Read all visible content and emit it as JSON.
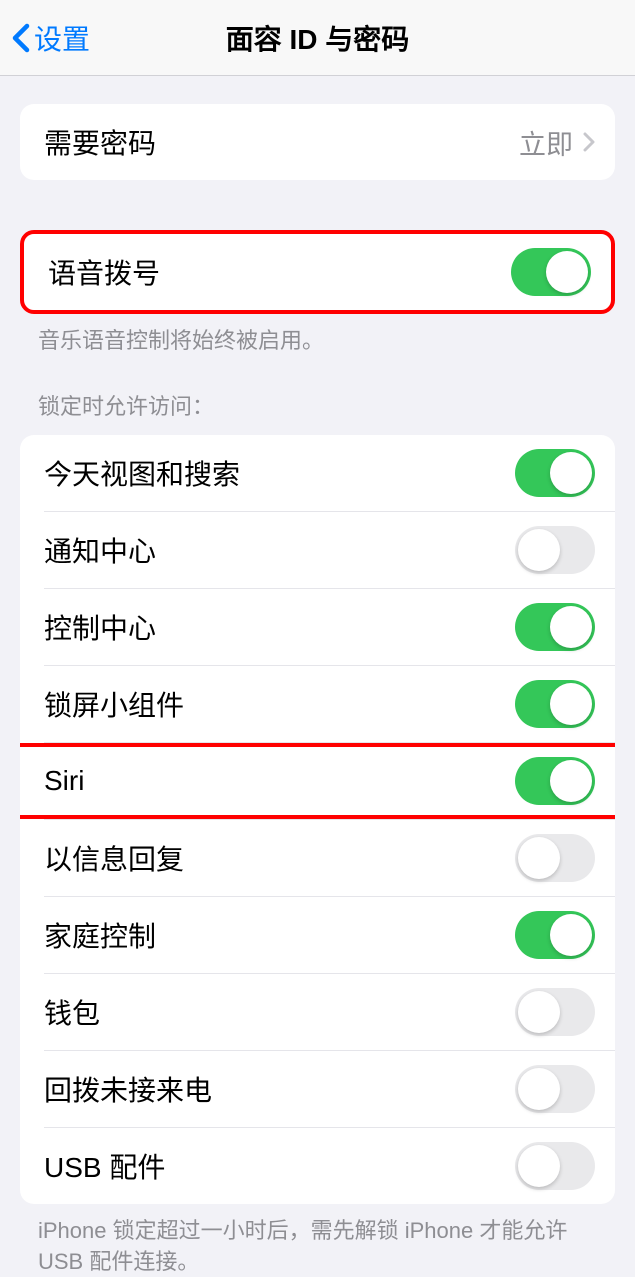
{
  "header": {
    "back_label": "设置",
    "title": "面容 ID 与密码"
  },
  "require_passcode": {
    "label": "需要密码",
    "value": "立即"
  },
  "voice_dial": {
    "label": "语音拨号",
    "enabled": true,
    "footer": "音乐语音控制将始终被启用。"
  },
  "lock_access": {
    "header": "锁定时允许访问：",
    "items": [
      {
        "label": "今天视图和搜索",
        "enabled": true
      },
      {
        "label": "通知中心",
        "enabled": false
      },
      {
        "label": "控制中心",
        "enabled": true
      },
      {
        "label": "锁屏小组件",
        "enabled": true
      },
      {
        "label": "Siri",
        "enabled": true
      },
      {
        "label": "以信息回复",
        "enabled": false
      },
      {
        "label": "家庭控制",
        "enabled": true
      },
      {
        "label": "钱包",
        "enabled": false
      },
      {
        "label": "回拨未接来电",
        "enabled": false
      },
      {
        "label": "USB 配件",
        "enabled": false
      }
    ],
    "footer": "iPhone 锁定超过一小时后，需先解锁 iPhone 才能允许 USB 配件连接。"
  },
  "highlighted_indices": [
    4
  ],
  "colors": {
    "accent": "#007aff",
    "toggle_on": "#34c759",
    "toggle_off": "#e9e9eb",
    "highlight": "#ff0000"
  }
}
